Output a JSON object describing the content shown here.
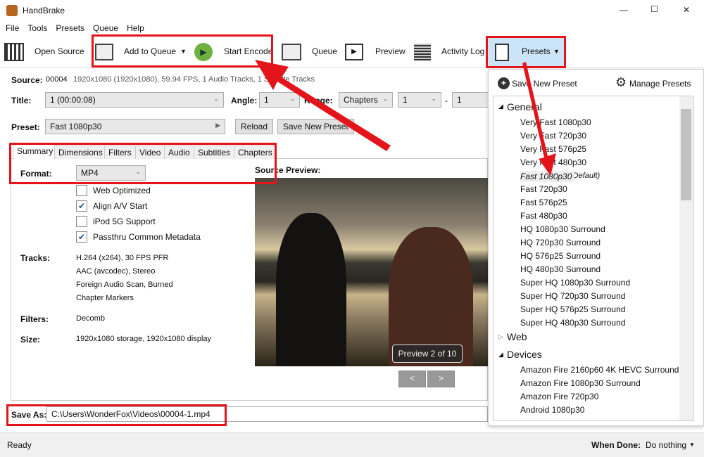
{
  "window": {
    "title": "HandBrake",
    "minimize": "—",
    "maximize": "☐",
    "close": "✕"
  },
  "menu": [
    "File",
    "Tools",
    "Presets",
    "Queue",
    "Help"
  ],
  "toolbar": {
    "open_source": "Open Source",
    "add_to_queue": "Add to Queue",
    "start_encode": "Start Encode",
    "queue": "Queue",
    "preview": "Preview",
    "activity_log": "Activity Log",
    "presets": "Presets"
  },
  "source": {
    "label": "Source:",
    "name": "00004",
    "info": "1920x1080 (1920x1080), 59.94 FPS, 1 Audio Tracks, 1 Subtitle Tracks"
  },
  "title_row": {
    "title_label": "Title:",
    "title_value": "1  (00:00:08)",
    "angle_label": "Angle:",
    "angle_value": "1",
    "range_label": "Range:",
    "range_value": "Chapters",
    "range_start": "1",
    "dash": "-",
    "range_end": "1"
  },
  "preset_row": {
    "label": "Preset:",
    "value": "Fast 1080p30",
    "reload": "Reload",
    "save_new": "Save New Preset"
  },
  "tabs": [
    "Summary",
    "Dimensions",
    "Filters",
    "Video",
    "Audio",
    "Subtitles",
    "Chapters"
  ],
  "summary": {
    "format_label": "Format:",
    "format_value": "MP4",
    "options": [
      {
        "label": "Web Optimized",
        "checked": false
      },
      {
        "label": "Align A/V Start",
        "checked": true
      },
      {
        "label": "iPod 5G Support",
        "checked": false
      },
      {
        "label": "Passthru Common Metadata",
        "checked": true
      }
    ],
    "tracks_label": "Tracks:",
    "tracks": [
      "H.264 (x264), 30 FPS PFR",
      "AAC (avcodec), Stereo",
      "Foreign Audio Scan, Burned",
      "Chapter Markers"
    ],
    "filters_label": "Filters:",
    "filters": "Decomb",
    "size_label": "Size:",
    "size": "1920x1080 storage, 1920x1080 display"
  },
  "preview": {
    "label": "Source Preview:",
    "badge": "Preview 2 of 10",
    "prev": "<",
    "next": ">"
  },
  "save_as": {
    "label": "Save As:",
    "value": "C:\\Users\\WonderFox\\Videos\\00004-1.mp4"
  },
  "status": {
    "text": "Ready",
    "when_done_label": "When Done:",
    "when_done_value": "Do nothing"
  },
  "presets_panel": {
    "save_new": "Save New Preset",
    "manage": "Manage Presets",
    "groups": [
      {
        "name": "General",
        "expanded": true,
        "items": [
          "Very Fast 1080p30",
          "Very Fast 720p30",
          "Very Fast 576p25",
          "Very Fast 480p30",
          "Fast 1080p30",
          "Fast 720p30",
          "Fast 576p25",
          "Fast 480p30",
          "HQ 1080p30 Surround",
          "HQ 720p30 Surround",
          "HQ 576p25 Surround",
          "HQ 480p30 Surround",
          "Super HQ 1080p30 Surround",
          "Super HQ 720p30 Surround",
          "Super HQ 576p25 Surround",
          "Super HQ 480p30 Surround"
        ]
      },
      {
        "name": "Web",
        "expanded": false
      },
      {
        "name": "Devices",
        "expanded": true,
        "items": [
          "Amazon Fire 2160p60 4K HEVC Surround",
          "Amazon Fire 1080p30 Surround",
          "Amazon Fire 720p30",
          "Android 1080p30"
        ]
      }
    ],
    "default_tag": "(Default)",
    "selected": "Fast 1080p30"
  },
  "colors": {
    "annotation": "#e4141b",
    "toolbar_highlight": "#cce4f7"
  }
}
